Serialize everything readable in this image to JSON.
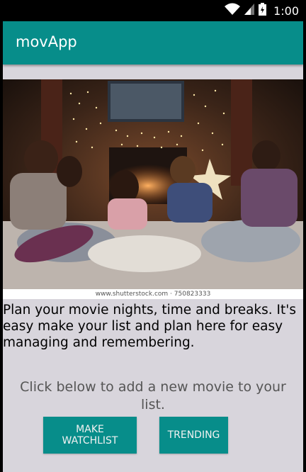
{
  "status_bar": {
    "time": "1:00",
    "icons": [
      "wifi-icon",
      "cell-signal-icon",
      "battery-icon"
    ]
  },
  "app_bar": {
    "title": "movApp",
    "color": "#078d8a"
  },
  "hero_image": {
    "watermark": "www.shutterstock.com · 750823333"
  },
  "content": {
    "description": "Plan your movie nights, time and breaks. It's easy make your list and plan here for easy managing and remembering.",
    "cta": "Click below to add a new movie to your list."
  },
  "buttons": {
    "make_watchlist": "MAKE WATCHLIST",
    "trending": "TRENDING"
  },
  "colors": {
    "accent": "#078d8a",
    "background": "#d8d5dc"
  }
}
